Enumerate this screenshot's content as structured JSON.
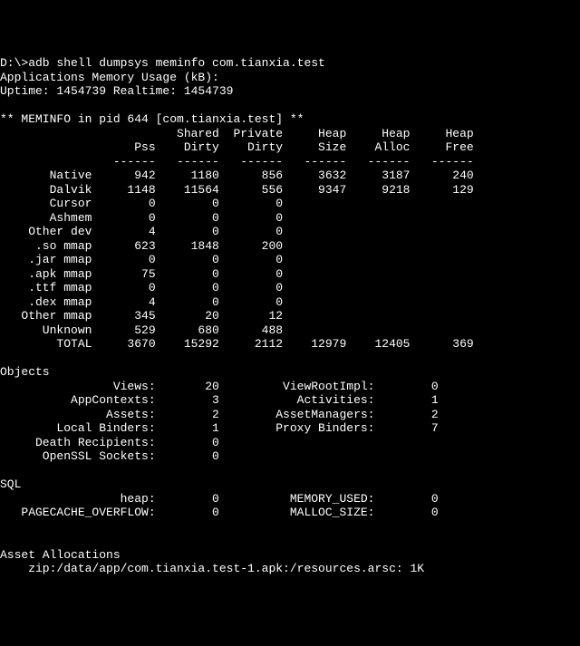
{
  "prompt": "D:\\>adb shell dumpsys meminfo com.tianxia.test",
  "header1": "Applications Memory Usage (kB):",
  "header2": "Uptime: 1454739 Realtime: 1454739",
  "meminfo_title": "** MEMINFO in pid 644 [com.tianxia.test] **",
  "columns": {
    "c1": "Pss",
    "c2": "Shared",
    "c2b": "Dirty",
    "c3": "Private",
    "c3b": "Dirty",
    "c4": "Heap",
    "c4b": "Size",
    "c5": "Heap",
    "c5b": "Alloc",
    "c6": "Heap",
    "c6b": "Free"
  },
  "dashes": "------",
  "rows": [
    {
      "label": "Native",
      "pss": "942",
      "sd": "1180",
      "pd": "856",
      "hs": "3632",
      "ha": "3187",
      "hf": "240"
    },
    {
      "label": "Dalvik",
      "pss": "1148",
      "sd": "11564",
      "pd": "556",
      "hs": "9347",
      "ha": "9218",
      "hf": "129"
    },
    {
      "label": "Cursor",
      "pss": "0",
      "sd": "0",
      "pd": "0",
      "hs": "",
      "ha": "",
      "hf": ""
    },
    {
      "label": "Ashmem",
      "pss": "0",
      "sd": "0",
      "pd": "0",
      "hs": "",
      "ha": "",
      "hf": ""
    },
    {
      "label": "Other dev",
      "pss": "4",
      "sd": "0",
      "pd": "0",
      "hs": "",
      "ha": "",
      "hf": ""
    },
    {
      "label": ".so mmap",
      "pss": "623",
      "sd": "1848",
      "pd": "200",
      "hs": "",
      "ha": "",
      "hf": ""
    },
    {
      "label": ".jar mmap",
      "pss": "0",
      "sd": "0",
      "pd": "0",
      "hs": "",
      "ha": "",
      "hf": ""
    },
    {
      "label": ".apk mmap",
      "pss": "75",
      "sd": "0",
      "pd": "0",
      "hs": "",
      "ha": "",
      "hf": ""
    },
    {
      "label": ".ttf mmap",
      "pss": "0",
      "sd": "0",
      "pd": "0",
      "hs": "",
      "ha": "",
      "hf": ""
    },
    {
      "label": ".dex mmap",
      "pss": "4",
      "sd": "0",
      "pd": "0",
      "hs": "",
      "ha": "",
      "hf": ""
    },
    {
      "label": "Other mmap",
      "pss": "345",
      "sd": "20",
      "pd": "12",
      "hs": "",
      "ha": "",
      "hf": ""
    },
    {
      "label": "Unknown",
      "pss": "529",
      "sd": "680",
      "pd": "488",
      "hs": "",
      "ha": "",
      "hf": ""
    },
    {
      "label": "TOTAL",
      "pss": "3670",
      "sd": "15292",
      "pd": "2112",
      "hs": "12979",
      "ha": "12405",
      "hf": "369"
    }
  ],
  "objects_title": "Objects",
  "objects_rows": [
    {
      "l1": "Views:",
      "v1": "20",
      "l2": "ViewRootImpl:",
      "v2": "0"
    },
    {
      "l1": "AppContexts:",
      "v1": "3",
      "l2": "Activities:",
      "v2": "1"
    },
    {
      "l1": "Assets:",
      "v1": "2",
      "l2": "AssetManagers:",
      "v2": "2"
    },
    {
      "l1": "Local Binders:",
      "v1": "1",
      "l2": "Proxy Binders:",
      "v2": "7"
    },
    {
      "l1": "Death Recipients:",
      "v1": "0",
      "l2": "",
      "v2": ""
    },
    {
      "l1": "OpenSSL Sockets:",
      "v1": "0",
      "l2": "",
      "v2": ""
    }
  ],
  "sql_title": "SQL",
  "sql_rows": [
    {
      "l1": "heap:",
      "v1": "0",
      "l2": "MEMORY_USED:",
      "v2": "0"
    },
    {
      "l1": "PAGECACHE_OVERFLOW:",
      "v1": "0",
      "l2": "MALLOC_SIZE:",
      "v2": "0"
    }
  ],
  "asset_title": "Asset Allocations",
  "asset_line": "    zip:/data/app/com.tianxia.test-1.apk:/resources.arsc: 1K"
}
